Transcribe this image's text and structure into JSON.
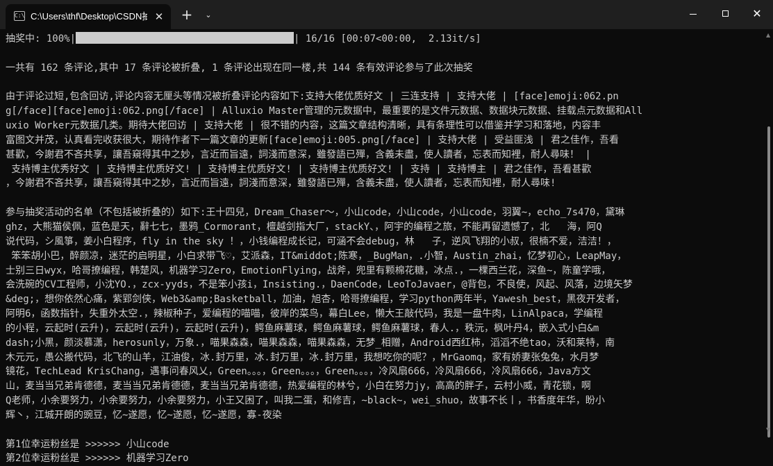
{
  "window": {
    "tab_icon": "C:\\",
    "tab_title": "C:\\Users\\thf\\Desktop\\CSDN抽",
    "tab_close": "✕",
    "new_tab": "+",
    "dropdown": "⌄",
    "close": "✕",
    "icons": [
      "terminal-icon",
      "close-icon",
      "plus-icon",
      "chevron-down-icon",
      "minimize-icon",
      "maximize-icon",
      "close-icon"
    ]
  },
  "console": {
    "progress": {
      "prefix": "抽奖中: 100%|",
      "suffix": "| 16/16 [00:07<00:00,  2.13it/s]",
      "percent": 100
    },
    "lines": [
      "",
      "一共有 162 条评论,其中 17 条评论被折叠, 1 条评论出现在同一楼,共 144 条有效评论参与了此次抽奖",
      "",
      "由于评论过短,包含回访,评论内容无厘头等情况被折叠评论内容如下:支持大佬优质好文 | 三连支持 | 支持大佬 | [face]emoji:062.pn",
      "g[/face][face]emoji:062.png[/face] | Alluxio Master管理的元数据中，最重要的是文件元数据、数据块元数据、挂载点元数据和All",
      "uxio Worker元数据几类。期待大佬回访 | 支持大佬 | 很不错的内容，这篇文章结构清晰，具有条理性可以借鉴并学习和落地，内容丰",
      "富图文并茂，认真看完收获很大，期待作者下一篇文章的更新[face]emoji:005.png[/face] | 支持大佬 | 受益匪浅 | 君之佳作，吾看",
      "甚歡，今謝君不吝共享，讓吾窺得其中之妙，言近而旨遠，詞淺而意深，雖發語已殫，含義未盡，使人讀者，忘表而知裡，耐人尋味！ |",
      " 支持博主优秀好文 | 支持博主优质好文! | 支持博主优质好文! | 支持博主优质好文! | 支持 | 支持博主 | 君之佳作，吾看甚歡",
      "，今謝君不吝共享，讓吾窺得其中之妙，言近而旨遠，詞淺而意深，雖發語已殫，含義未盡，使人讀者，忘表而知裡，耐人尋味!",
      "",
      "参与抽奖活动的名单（不包括被折叠的）如下:王十四兒，Dream_Chaser～，小山code，小山code，小山code，羽翼~，echo_7s470，黛琳",
      "ghz，大熊猫侯佩，蓝色是天，辭七七，墨鸦_Cormorant，檀越剑指大厂，stackY、，阿宇的编程之旅，不能再留遗憾了，北   海，阿Q",
      "说代码，シ風箏，姜小白程序，fly in the sky ！，小钱编程成长记，可涵不会debug，林   子，逆风飞翔的小叔，很楠不爱，洁洁！，",
      " 笨笨胡小巴，醉颜凉，迷茫的启明星，小白求带飞♡，艾派森，IT&middot;陈寒，_BugMan，.小智，Austin_zhai，忆梦初心，LeapMay，",
      "士别三日wyx，哈哥撩编程，韩楚风，机器学习Zero，EmotionFlying，战斧，兜里有颗棉花糖，冰点.，一棵西兰花，深鱼~，陈童学哦，",
      "会洗碗的CV工程师，小沈YO.，zcx-yyds，不是笨小孩i，Insisting.，DaenCode，LeoToJavaer，@背包，不良使，风起、风落，边境矢梦",
      "&deg;，想你依然心痛，紫郢剑侠，Web3&amp;Basketball，加油，旭杏，哈哥撩编程，学习python两年半，Yawesh_best，黑夜开发者，",
      "阿明6，函数指针，失重外太空.，辣椒种子，爱编程的喵喵，彼岸的菜鸟，幕白Lee，懒大王敲代码，我是一盘牛肉，LinAlpaca，学编程",
      "的小程，云起时(云升)，云起时(云升)，云起时(云升)，鳄鱼麻薯球，鳄鱼麻薯球，鳄鱼麻薯球，春人.，秩沅，枫叶丹4，嵌入式小白&m",
      "dash;小黑，颜淡慕潇，herosunly，万象.，喵果森森，喵果森森，喵果森森，无梦_相赠，Android西红柿，滔滔不绝tao，沃和莱特，南",
      "木元元，愚公搬代码，北飞的山羊，江油俊，冰.封万里，冰.封万里，冰.封万里，我想吃你的呢？，MrGaomq，家有娇妻张兔兔，水月梦",
      "镜花，TechLead KrisChang，遇事问春风乂，Green。。。，Green。。。，Green。。。，冷风扇666，冷风扇666，冷风扇666，Java方文",
      "山，麦当当兄弟肯德德，麦当当兄弟肯德德，麦当当兄弟肯德德，热爱编程的林兮，小白在努力jy，高高的胖子，云村小威，青花锁，啊",
      "Q老师，小余要努力，小余要努力，小余要努力，小王又困了，叫我二蛋，和修吉，~black~，wei_shuo，故事不长丨，书香度年华，盼小",
      "辉丶，江城开朗的豌豆，忆~遂愿，忆~遂愿，忆~遂愿，寡-夜染",
      "",
      "第1位幸运粉丝是 >>>>>> 小山code",
      "第2位幸运粉丝是 >>>>>> 机器学习Zero"
    ]
  },
  "colors": {
    "background": "#0c0c0c",
    "titlebar": "#1f1f1f",
    "text": "#cccccc",
    "progress_fill": "#cccccc"
  }
}
